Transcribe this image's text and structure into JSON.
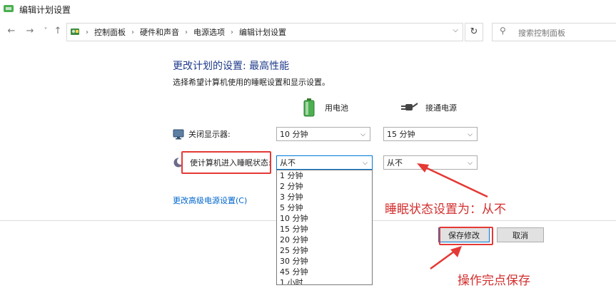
{
  "window": {
    "title": "编辑计划设置"
  },
  "nav": {
    "back": "←",
    "forward": "→",
    "history": "˅",
    "up": "↑",
    "refresh": "↻"
  },
  "breadcrumbs": [
    "控制面板",
    "硬件和声音",
    "电源选项",
    "编辑计划设置"
  ],
  "search": {
    "placeholder": "搜索控制面板"
  },
  "plan": {
    "title": "更改计划的设置: 最高性能",
    "subtitle": "选择希望计算机使用的睡眠设置和显示设置。",
    "col_battery": "用电池",
    "col_plugged": "接通电源",
    "rows": [
      {
        "label": "关闭显示器:",
        "battery": "10 分钟",
        "plugged": "15 分钟"
      },
      {
        "label": "使计算机进入睡眠状态:",
        "battery": "从不",
        "plugged": "从不"
      }
    ],
    "advanced_link": "更改高级电源设置(C)"
  },
  "dropdown_options": [
    "1 分钟",
    "2 分钟",
    "3 分钟",
    "5 分钟",
    "10 分钟",
    "15 分钟",
    "20 分钟",
    "25 分钟",
    "30 分钟",
    "45 分钟",
    "1 小时"
  ],
  "buttons": {
    "save": "保存修改",
    "cancel": "取消"
  },
  "annotations": {
    "sleep": "睡眠状态设置为：从不",
    "save": "操作完点保存"
  },
  "colors": {
    "annotation": "#e53935",
    "link": "#0066cc",
    "heading": "#1e3a8a",
    "focus": "#0078d7"
  }
}
